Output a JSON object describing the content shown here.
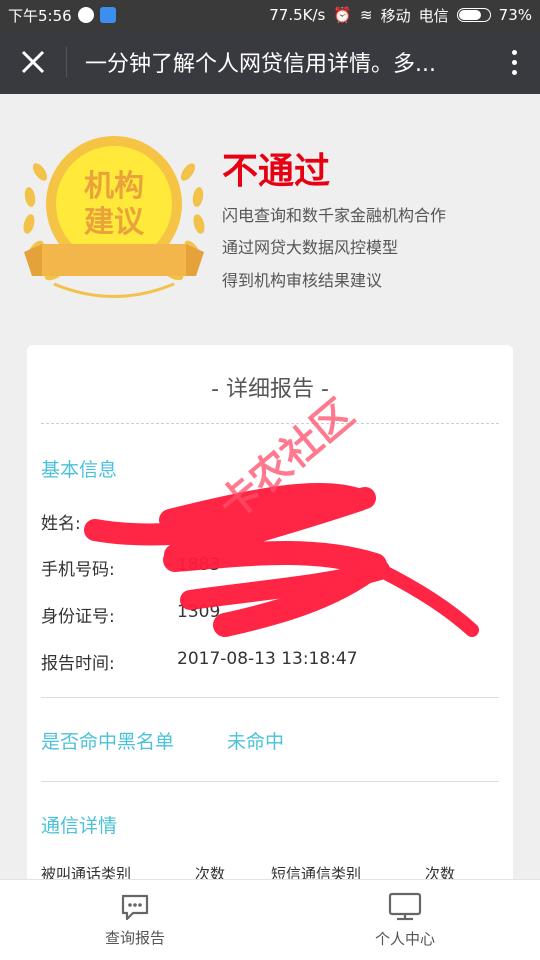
{
  "status_bar": {
    "time": "下午5:56",
    "speed": "77.5K/s",
    "carrier1": "移动",
    "carrier2": "电信",
    "battery": "73%",
    "battery_level": 0.73
  },
  "title_bar": {
    "title": "一分钟了解个人网贷信用详情。多..."
  },
  "result": {
    "medal_text_line1": "机构",
    "medal_text_line2": "建议",
    "status": "不通过",
    "lines": [
      "闪电查询和数千家金融机构合作",
      "通过网贷大数据风控模型",
      "得到机构审核结果建议"
    ]
  },
  "report": {
    "title": "- 详细报告 -",
    "basic_info": {
      "title": "基本信息",
      "fields": [
        {
          "label": "姓名:",
          "value": ""
        },
        {
          "label": "手机号码:",
          "value": "1883"
        },
        {
          "label": "身份证号:",
          "value": "1309"
        },
        {
          "label": "报告时间:",
          "value": "2017-08-13 13:18:47"
        }
      ]
    },
    "blacklist": {
      "label": "是否命中黑名单",
      "value": "未命中"
    },
    "comm": {
      "title": "通信详情",
      "headers": [
        "被叫通话类别",
        "次数",
        "短信通信类别",
        "次数"
      ]
    },
    "watermark": "卡农社区"
  },
  "bottom_nav": {
    "items": [
      {
        "label": "查询报告",
        "icon": "chat-icon"
      },
      {
        "label": "个人中心",
        "icon": "monitor-icon"
      }
    ]
  },
  "colors": {
    "accent": "#4cc1d9",
    "alert": "#e60012",
    "titlebar": "#393a3f"
  }
}
